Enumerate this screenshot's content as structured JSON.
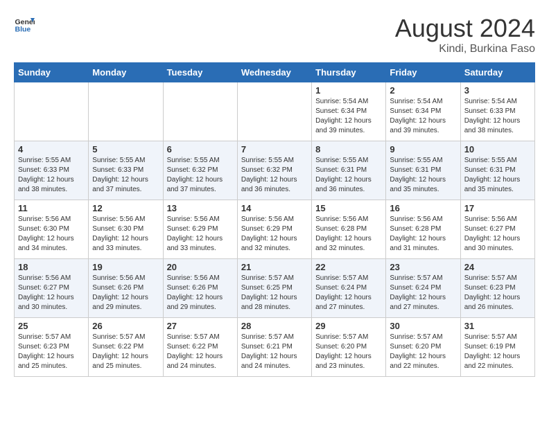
{
  "header": {
    "logo_general": "General",
    "logo_blue": "Blue",
    "month_year": "August 2024",
    "location": "Kindi, Burkina Faso"
  },
  "days_of_week": [
    "Sunday",
    "Monday",
    "Tuesday",
    "Wednesday",
    "Thursday",
    "Friday",
    "Saturday"
  ],
  "weeks": [
    [
      {
        "day": "",
        "detail": ""
      },
      {
        "day": "",
        "detail": ""
      },
      {
        "day": "",
        "detail": ""
      },
      {
        "day": "",
        "detail": ""
      },
      {
        "day": "1",
        "detail": "Sunrise: 5:54 AM\nSunset: 6:34 PM\nDaylight: 12 hours\nand 39 minutes."
      },
      {
        "day": "2",
        "detail": "Sunrise: 5:54 AM\nSunset: 6:34 PM\nDaylight: 12 hours\nand 39 minutes."
      },
      {
        "day": "3",
        "detail": "Sunrise: 5:54 AM\nSunset: 6:33 PM\nDaylight: 12 hours\nand 38 minutes."
      }
    ],
    [
      {
        "day": "4",
        "detail": "Sunrise: 5:55 AM\nSunset: 6:33 PM\nDaylight: 12 hours\nand 38 minutes."
      },
      {
        "day": "5",
        "detail": "Sunrise: 5:55 AM\nSunset: 6:33 PM\nDaylight: 12 hours\nand 37 minutes."
      },
      {
        "day": "6",
        "detail": "Sunrise: 5:55 AM\nSunset: 6:32 PM\nDaylight: 12 hours\nand 37 minutes."
      },
      {
        "day": "7",
        "detail": "Sunrise: 5:55 AM\nSunset: 6:32 PM\nDaylight: 12 hours\nand 36 minutes."
      },
      {
        "day": "8",
        "detail": "Sunrise: 5:55 AM\nSunset: 6:31 PM\nDaylight: 12 hours\nand 36 minutes."
      },
      {
        "day": "9",
        "detail": "Sunrise: 5:55 AM\nSunset: 6:31 PM\nDaylight: 12 hours\nand 35 minutes."
      },
      {
        "day": "10",
        "detail": "Sunrise: 5:55 AM\nSunset: 6:31 PM\nDaylight: 12 hours\nand 35 minutes."
      }
    ],
    [
      {
        "day": "11",
        "detail": "Sunrise: 5:56 AM\nSunset: 6:30 PM\nDaylight: 12 hours\nand 34 minutes."
      },
      {
        "day": "12",
        "detail": "Sunrise: 5:56 AM\nSunset: 6:30 PM\nDaylight: 12 hours\nand 33 minutes."
      },
      {
        "day": "13",
        "detail": "Sunrise: 5:56 AM\nSunset: 6:29 PM\nDaylight: 12 hours\nand 33 minutes."
      },
      {
        "day": "14",
        "detail": "Sunrise: 5:56 AM\nSunset: 6:29 PM\nDaylight: 12 hours\nand 32 minutes."
      },
      {
        "day": "15",
        "detail": "Sunrise: 5:56 AM\nSunset: 6:28 PM\nDaylight: 12 hours\nand 32 minutes."
      },
      {
        "day": "16",
        "detail": "Sunrise: 5:56 AM\nSunset: 6:28 PM\nDaylight: 12 hours\nand 31 minutes."
      },
      {
        "day": "17",
        "detail": "Sunrise: 5:56 AM\nSunset: 6:27 PM\nDaylight: 12 hours\nand 30 minutes."
      }
    ],
    [
      {
        "day": "18",
        "detail": "Sunrise: 5:56 AM\nSunset: 6:27 PM\nDaylight: 12 hours\nand 30 minutes."
      },
      {
        "day": "19",
        "detail": "Sunrise: 5:56 AM\nSunset: 6:26 PM\nDaylight: 12 hours\nand 29 minutes."
      },
      {
        "day": "20",
        "detail": "Sunrise: 5:56 AM\nSunset: 6:26 PM\nDaylight: 12 hours\nand 29 minutes."
      },
      {
        "day": "21",
        "detail": "Sunrise: 5:57 AM\nSunset: 6:25 PM\nDaylight: 12 hours\nand 28 minutes."
      },
      {
        "day": "22",
        "detail": "Sunrise: 5:57 AM\nSunset: 6:24 PM\nDaylight: 12 hours\nand 27 minutes."
      },
      {
        "day": "23",
        "detail": "Sunrise: 5:57 AM\nSunset: 6:24 PM\nDaylight: 12 hours\nand 27 minutes."
      },
      {
        "day": "24",
        "detail": "Sunrise: 5:57 AM\nSunset: 6:23 PM\nDaylight: 12 hours\nand 26 minutes."
      }
    ],
    [
      {
        "day": "25",
        "detail": "Sunrise: 5:57 AM\nSunset: 6:23 PM\nDaylight: 12 hours\nand 25 minutes."
      },
      {
        "day": "26",
        "detail": "Sunrise: 5:57 AM\nSunset: 6:22 PM\nDaylight: 12 hours\nand 25 minutes."
      },
      {
        "day": "27",
        "detail": "Sunrise: 5:57 AM\nSunset: 6:22 PM\nDaylight: 12 hours\nand 24 minutes."
      },
      {
        "day": "28",
        "detail": "Sunrise: 5:57 AM\nSunset: 6:21 PM\nDaylight: 12 hours\nand 24 minutes."
      },
      {
        "day": "29",
        "detail": "Sunrise: 5:57 AM\nSunset: 6:20 PM\nDaylight: 12 hours\nand 23 minutes."
      },
      {
        "day": "30",
        "detail": "Sunrise: 5:57 AM\nSunset: 6:20 PM\nDaylight: 12 hours\nand 22 minutes."
      },
      {
        "day": "31",
        "detail": "Sunrise: 5:57 AM\nSunset: 6:19 PM\nDaylight: 12 hours\nand 22 minutes."
      }
    ]
  ]
}
